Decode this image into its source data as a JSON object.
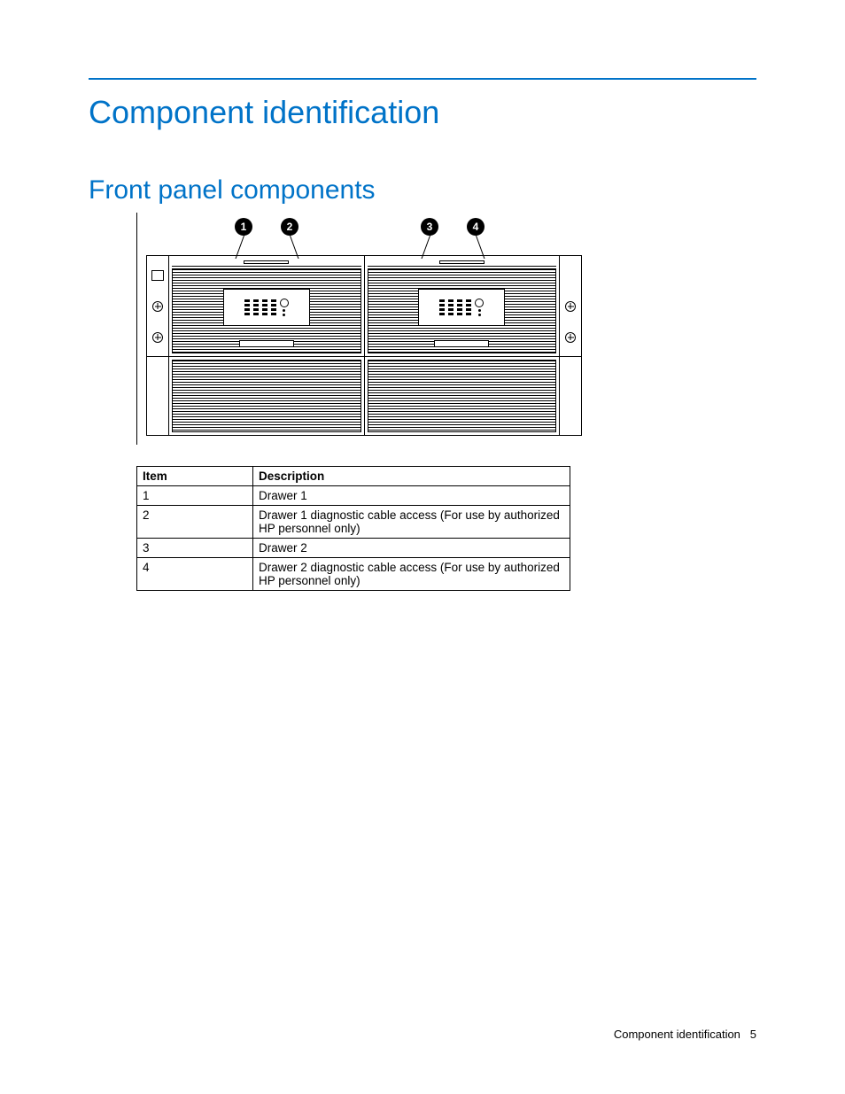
{
  "heading": "Component identification",
  "subheading": "Front panel components",
  "callouts": [
    "1",
    "2",
    "3",
    "4"
  ],
  "table": {
    "headers": [
      "Item",
      "Description"
    ],
    "rows": [
      {
        "item": "1",
        "desc": "Drawer 1"
      },
      {
        "item": "2",
        "desc": "Drawer 1 diagnostic cable access (For use by authorized HP personnel only)"
      },
      {
        "item": "3",
        "desc": "Drawer 2"
      },
      {
        "item": "4",
        "desc": "Drawer 2 diagnostic cable access (For use by authorized HP personnel only)"
      }
    ]
  },
  "footer": {
    "section": "Component identification",
    "page": "5"
  }
}
